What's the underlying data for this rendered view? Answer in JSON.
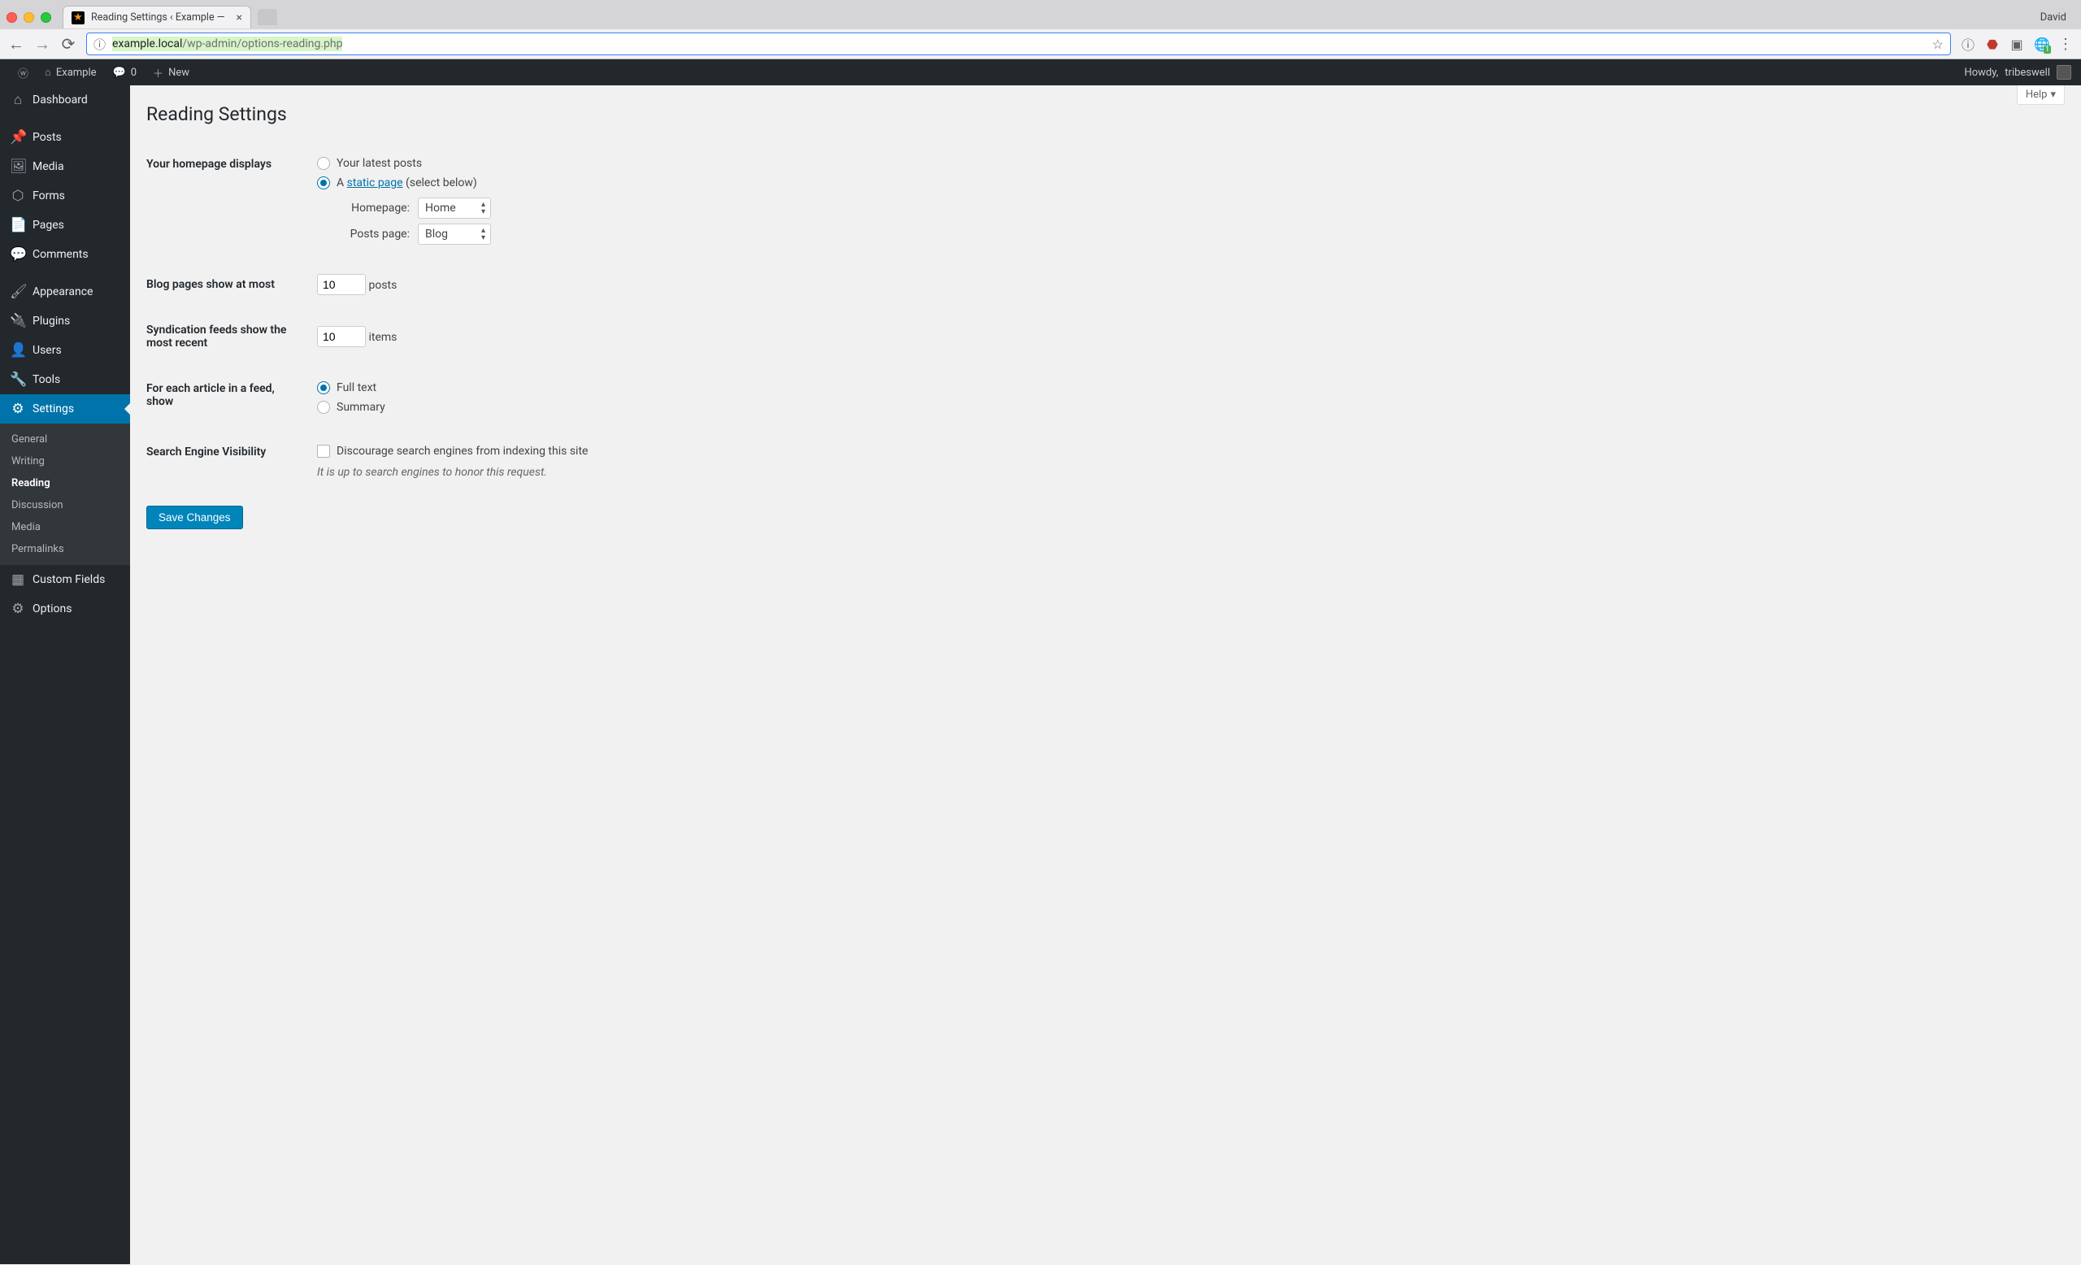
{
  "browser": {
    "tab_title": "Reading Settings ‹ Example —",
    "user": "David",
    "url_host": "example.local",
    "url_path": "/wp-admin/options-reading.php"
  },
  "adminbar": {
    "site_name": "Example",
    "comments_count": "0",
    "new_label": "New",
    "howdy_prefix": "Howdy, ",
    "howdy_user": "tribeswell"
  },
  "sidebar": {
    "items": [
      {
        "label": "Dashboard",
        "icon": "⌂"
      },
      {
        "label": "Posts",
        "icon": "📌"
      },
      {
        "label": "Media",
        "icon": "🖼"
      },
      {
        "label": "Forms",
        "icon": "⬡"
      },
      {
        "label": "Pages",
        "icon": "📄"
      },
      {
        "label": "Comments",
        "icon": "💬"
      },
      {
        "label": "Appearance",
        "icon": "🖌"
      },
      {
        "label": "Plugins",
        "icon": "🔌"
      },
      {
        "label": "Users",
        "icon": "👤"
      },
      {
        "label": "Tools",
        "icon": "🔧"
      },
      {
        "label": "Settings",
        "icon": "⚙"
      },
      {
        "label": "Custom Fields",
        "icon": "▦"
      },
      {
        "label": "Options",
        "icon": "⚙"
      }
    ],
    "submenu": [
      "General",
      "Writing",
      "Reading",
      "Discussion",
      "Media",
      "Permalinks"
    ]
  },
  "page": {
    "help_label": "Help",
    "title": "Reading Settings",
    "save_button": "Save Changes",
    "homepage_displays_label": "Your homepage displays",
    "latest_posts_label": "Your latest posts",
    "static_page_prefix": "A ",
    "static_page_link": "static page",
    "static_page_suffix": " (select below)",
    "homepage_select_label": "Homepage:",
    "homepage_select_value": "Home",
    "postspage_select_label": "Posts page:",
    "postspage_select_value": "Blog",
    "blog_pages_label": "Blog pages show at most",
    "blog_pages_value": "10",
    "blog_pages_suffix": "posts",
    "syndication_label": "Syndication feeds show the most recent",
    "syndication_value": "10",
    "syndication_suffix": "items",
    "feed_article_label": "For each article in a feed, show",
    "feed_fulltext": "Full text",
    "feed_summary": "Summary",
    "sev_label": "Search Engine Visibility",
    "sev_checkbox_label": "Discourage search engines from indexing this site",
    "sev_description": "It is up to search engines to honor this request."
  }
}
